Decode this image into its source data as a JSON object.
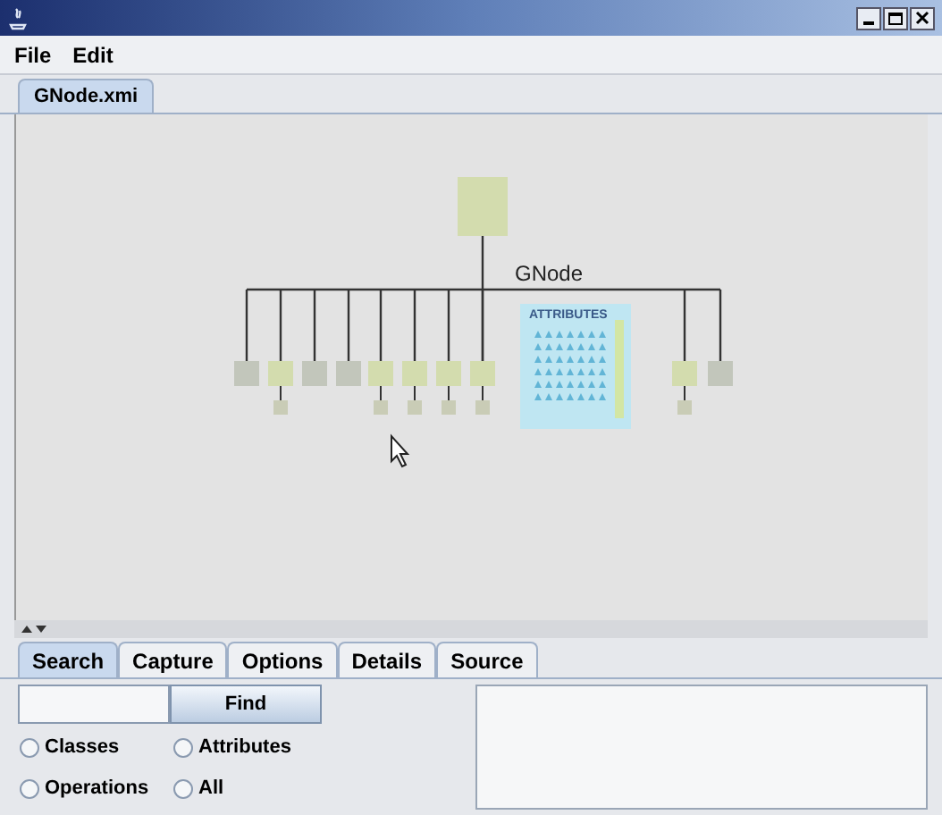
{
  "menu": [
    "File",
    "Edit"
  ],
  "document_tabs": [
    {
      "label": "GNode.xmi",
      "selected": true
    }
  ],
  "diagram": {
    "class_name": "GNode",
    "section_label": "ATTRIBUTES"
  },
  "panel_tabs": [
    {
      "label": "Search",
      "selected": true
    },
    {
      "label": "Capture",
      "selected": false
    },
    {
      "label": "Options",
      "selected": false
    },
    {
      "label": "Details",
      "selected": false
    },
    {
      "label": "Source",
      "selected": false
    }
  ],
  "search": {
    "find_button": "Find",
    "options": [
      {
        "label": "Classes",
        "selected": false
      },
      {
        "label": "Attributes",
        "selected": false
      },
      {
        "label": "Operations",
        "selected": false
      },
      {
        "label": "All",
        "selected": false
      }
    ]
  }
}
